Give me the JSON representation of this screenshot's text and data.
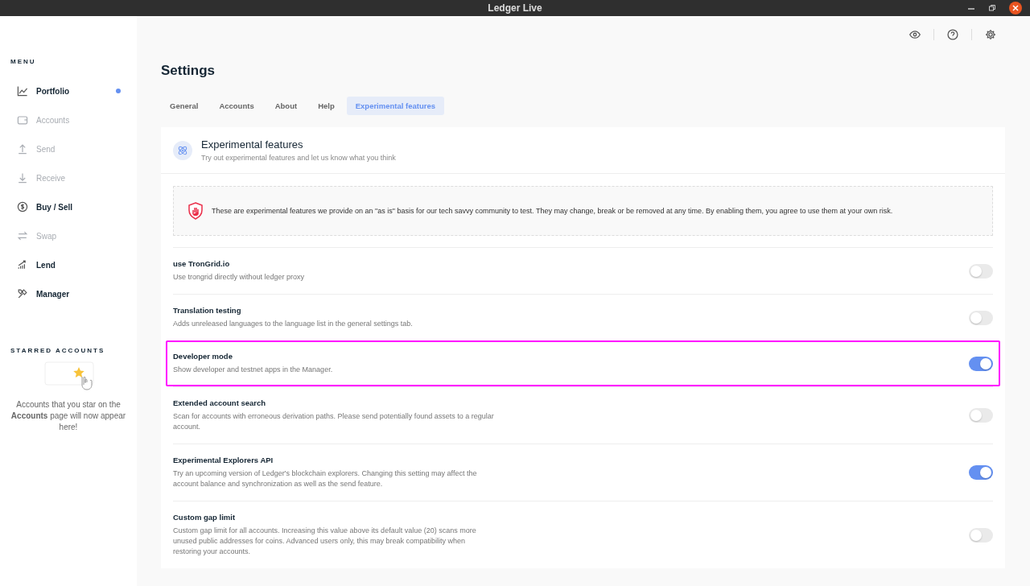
{
  "window": {
    "title": "Ledger Live"
  },
  "sidebar": {
    "menu_heading": "MENU",
    "items": [
      {
        "label": "Portfolio",
        "disabled": false,
        "notified": true
      },
      {
        "label": "Accounts",
        "disabled": true,
        "notified": false
      },
      {
        "label": "Send",
        "disabled": true,
        "notified": false
      },
      {
        "label": "Receive",
        "disabled": true,
        "notified": false
      },
      {
        "label": "Buy / Sell",
        "disabled": false,
        "notified": false
      },
      {
        "label": "Swap",
        "disabled": true,
        "notified": false
      },
      {
        "label": "Lend",
        "disabled": false,
        "notified": false
      },
      {
        "label": "Manager",
        "disabled": false,
        "notified": false
      }
    ],
    "starred_heading": "STARRED ACCOUNTS",
    "starred_empty": "Accounts that you star on the **Accounts** page will now appear here!"
  },
  "page": {
    "title": "Settings"
  },
  "tabs": [
    {
      "label": "General",
      "selected": false
    },
    {
      "label": "Accounts",
      "selected": false
    },
    {
      "label": "About",
      "selected": false
    },
    {
      "label": "Help",
      "selected": false
    },
    {
      "label": "Experimental features",
      "selected": true
    }
  ],
  "section": {
    "title": "Experimental features",
    "subtitle": "Try out experimental features and let us know what you think"
  },
  "warning": "These are experimental features we provide on an \"as is\" basis for our tech savvy community to test. They may change, break or be removed at any time. By enabling them, you agree to use them at your own risk.",
  "settings": [
    {
      "title": "use TronGrid.io",
      "description": "Use trongrid directly without ledger proxy",
      "on": false,
      "highlighted": false
    },
    {
      "title": "Translation testing",
      "description": "Adds unreleased languages to the language list in the general settings tab.",
      "on": false,
      "highlighted": false
    },
    {
      "title": "Developer mode",
      "description": "Show developer and testnet apps in the Manager.",
      "on": true,
      "highlighted": true
    },
    {
      "title": "Extended account search",
      "description": "Scan for accounts with erroneous derivation paths. Please send potentially found assets to a regular account.",
      "on": false,
      "highlighted": false
    },
    {
      "title": "Experimental Explorers API",
      "description": "Try an upcoming version of Ledger's blockchain explorers. Changing this setting may affect the account balance and synchronization as well as the send feature.",
      "on": true,
      "highlighted": false
    },
    {
      "title": "Custom gap limit",
      "description": "Custom gap limit for all accounts. Increasing this value above its default value (20) scans more unused public addresses for coins. Advanced users only, this may break compatibility when restoring your accounts.",
      "on": false,
      "highlighted": false
    }
  ]
}
